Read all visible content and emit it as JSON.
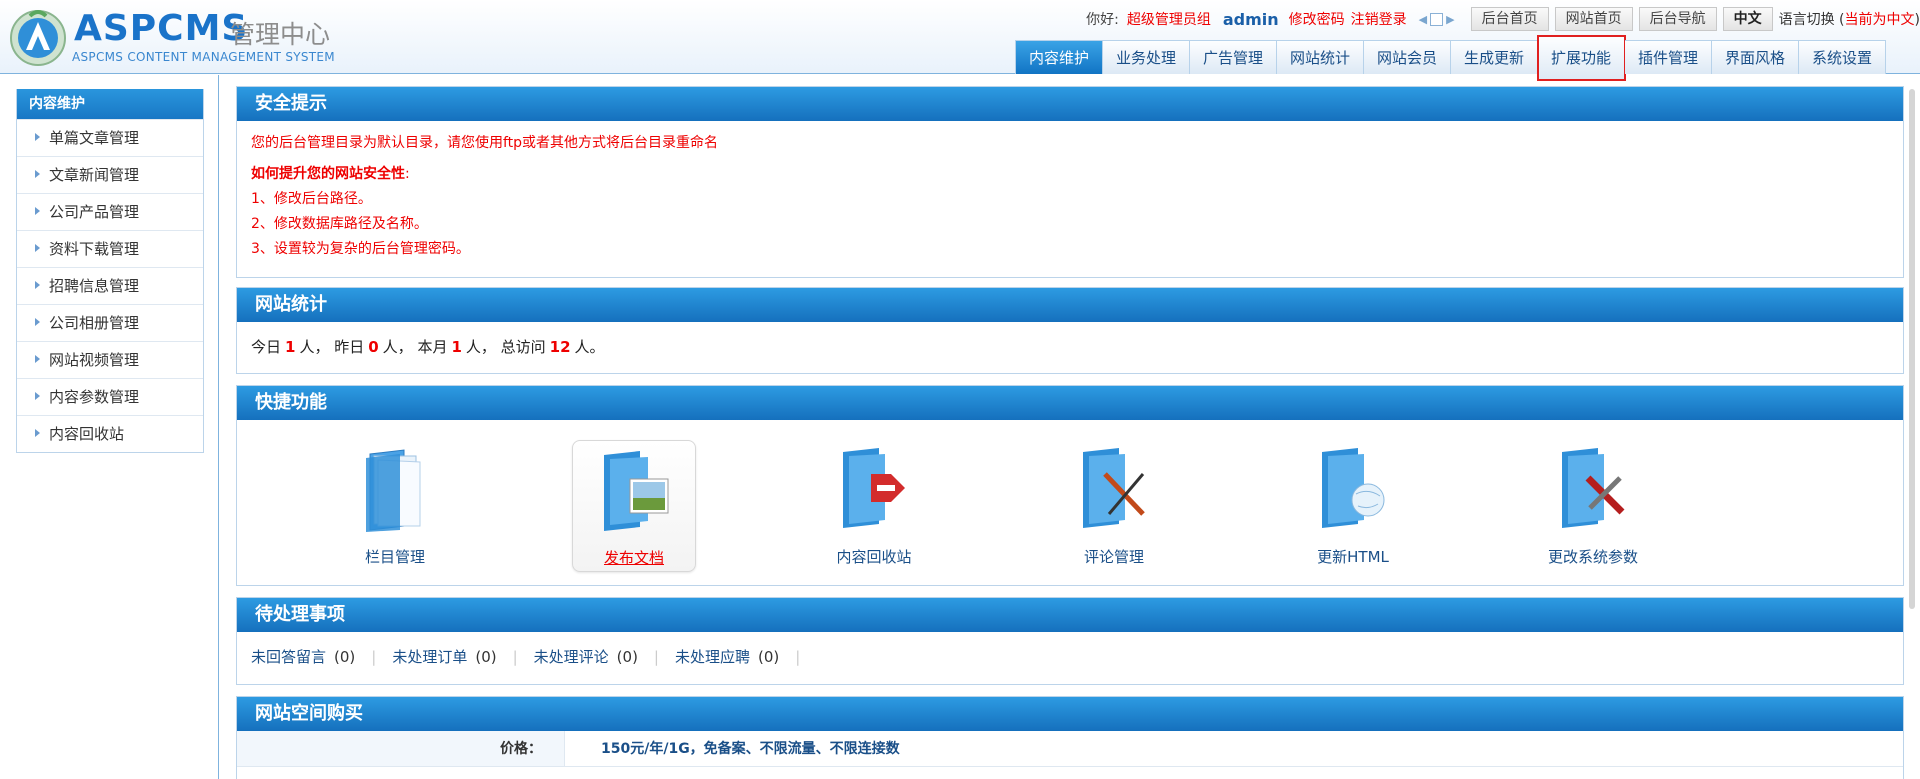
{
  "header": {
    "logo_text": "ASPCMS",
    "logo_sub": "管理中心",
    "logo_en": "ASPCMS CONTENT MANAGEMENT SYSTEM",
    "greeting": "你好:",
    "user_group": "超级管理员组",
    "username": "admin",
    "change_password": "修改密码",
    "logout": "注销登录",
    "buttons": [
      "后台首页",
      "网站首页",
      "后台导航",
      "中文"
    ],
    "lang_label": "语言切换 (",
    "lang_current": "当前为中文",
    "lang_close": ")"
  },
  "nav": {
    "tabs": [
      {
        "label": "内容维护"
      },
      {
        "label": "业务处理"
      },
      {
        "label": "广告管理"
      },
      {
        "label": "网站统计"
      },
      {
        "label": "网站会员"
      },
      {
        "label": "生成更新"
      },
      {
        "label": "扩展功能"
      },
      {
        "label": "插件管理"
      },
      {
        "label": "界面风格"
      },
      {
        "label": "系统设置"
      }
    ],
    "active_index": 0,
    "highlighted_index": 6
  },
  "sidebar": {
    "title": "内容维护",
    "items": [
      {
        "label": "单篇文章管理"
      },
      {
        "label": "文章新闻管理"
      },
      {
        "label": "公司产品管理"
      },
      {
        "label": "资料下载管理"
      },
      {
        "label": "招聘信息管理"
      },
      {
        "label": "公司相册管理"
      },
      {
        "label": "网站视频管理"
      },
      {
        "label": "内容参数管理"
      },
      {
        "label": "内容回收站"
      }
    ]
  },
  "security": {
    "title": "安全提示",
    "warning": "您的后台管理目录为默认目录，请您使用ftp或者其他方式将后台目录重命名",
    "how_title": "如何提升您的网站安全性",
    "how_colon": ":",
    "tips": [
      "1、修改后台路径。",
      "2、修改数据库路径及名称。",
      "3、设置较为复杂的后台管理密码。"
    ]
  },
  "stats": {
    "title": "网站统计",
    "today_label": "今日",
    "today": "1",
    "yesterday_label": "人， 昨日",
    "yesterday": "0",
    "month_label": "人， 本月",
    "month": "1",
    "total_label": "人， 总访问",
    "total": "12",
    "end": "人。"
  },
  "quick": {
    "title": "快捷功能",
    "items": [
      {
        "label": "栏目管理",
        "icon": "folder-book-icon"
      },
      {
        "label": "发布文档",
        "icon": "folder-image-icon"
      },
      {
        "label": "内容回收站",
        "icon": "folder-recycle-icon"
      },
      {
        "label": "评论管理",
        "icon": "folder-pen-icon"
      },
      {
        "label": "更新HTML",
        "icon": "folder-globe-icon"
      },
      {
        "label": "更改系统参数",
        "icon": "folder-tools-icon"
      }
    ],
    "selected_index": 1
  },
  "todo": {
    "title": "待处理事项",
    "items": [
      {
        "label": "未回答留言",
        "count": "(0)"
      },
      {
        "label": "未处理订单",
        "count": "(0)"
      },
      {
        "label": "未处理评论",
        "count": "(0)"
      },
      {
        "label": "未处理应聘",
        "count": "(0)"
      }
    ],
    "separator": "|"
  },
  "hosting": {
    "title": "网站空间购买",
    "price_label": "价格：",
    "price_value": "150元/年/1G，免备案、不限流量、不限连接数"
  },
  "colors": {
    "accent": "#1877c5",
    "alert": "#e00000",
    "link": "#1a4f88"
  }
}
